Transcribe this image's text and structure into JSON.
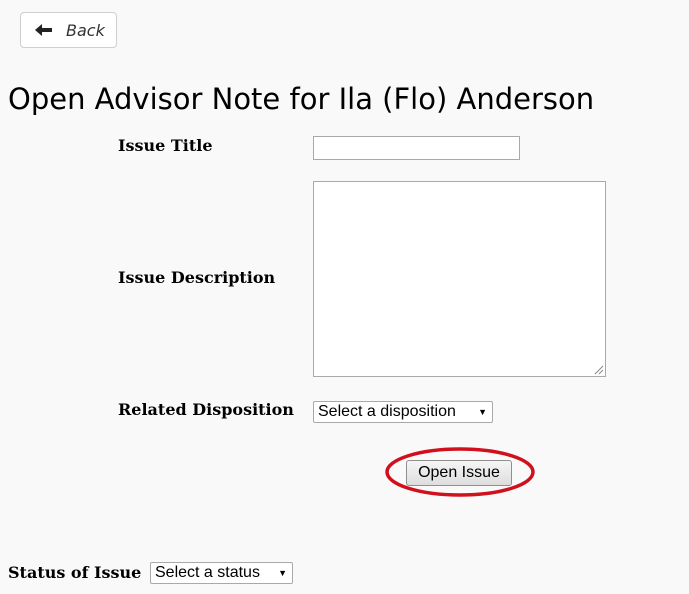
{
  "back_button": {
    "label": "Back",
    "icon": "arrow-left-icon"
  },
  "page_title": "Open Advisor Note for Ila (Flo) Anderson",
  "form": {
    "issue_title": {
      "label": "Issue Title",
      "value": ""
    },
    "issue_description": {
      "label": "Issue Description",
      "value": ""
    },
    "related_disposition": {
      "label": "Related Disposition",
      "selected": "Select a disposition"
    },
    "open_issue_button": {
      "label": "Open Issue"
    }
  },
  "status": {
    "label": "Status of Issue",
    "selected": "Select a status"
  },
  "colors": {
    "highlight": "#d0101c",
    "background": "#f9f9f9"
  }
}
